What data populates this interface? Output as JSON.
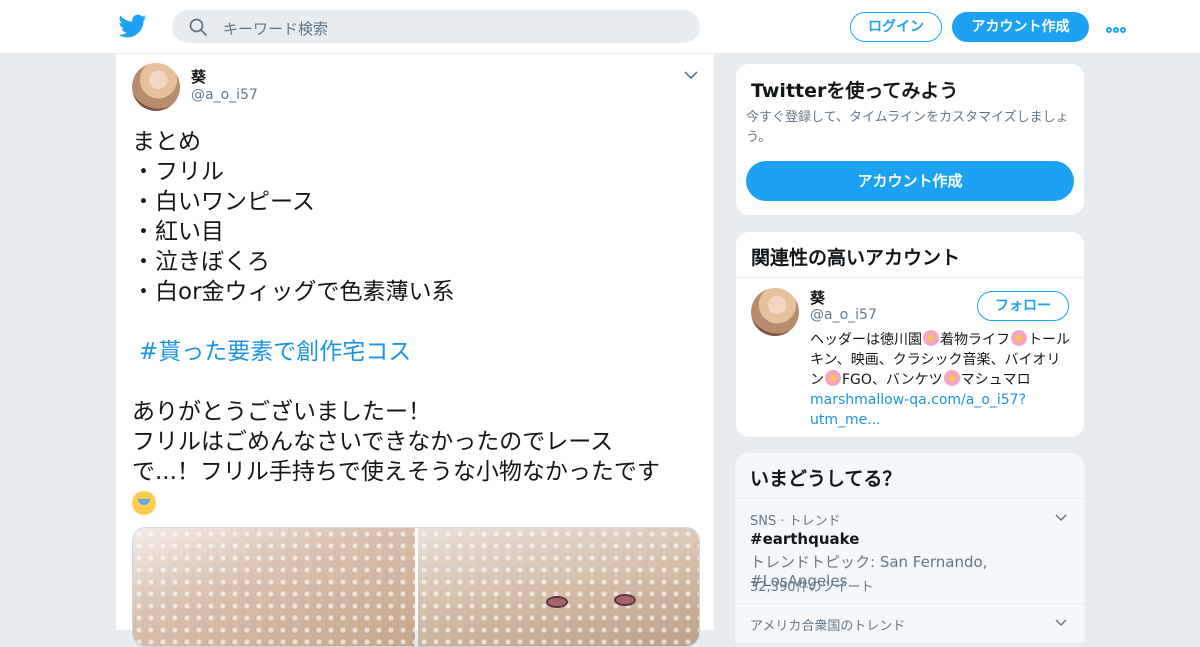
{
  "header": {
    "search_placeholder": "キーワード検索",
    "login_label": "ログイン",
    "signup_label": "アカウント作成"
  },
  "tweet": {
    "name": "葵",
    "handle": "@a_o_i57",
    "lines": [
      "まとめ",
      "・フリル",
      "・白いワンピース",
      "・紅い目",
      "・泣きぼくろ",
      "・白or金ウィッグで色素薄い系"
    ],
    "hashtag": "#貰った要素で創作宅コス",
    "lines2": [
      "ありがとうございましたー！",
      "フリルはごめんなさいできなかったのでレース",
      "で...！フリル手持ちで使えそうな小物なかったです"
    ],
    "emoji": "loudly-crying-face"
  },
  "signup_card": {
    "title": "Twitterを使ってみよう",
    "desc": "今すぐ登録して、タイムラインをカスタマイズしましょう。",
    "cta": "アカウント作成"
  },
  "related_card": {
    "title": "関連性の高いアカウント",
    "name": "葵",
    "handle": "@a_o_i57",
    "follow_label": "フォロー",
    "bio_parts": [
      "ヘッダーは徳川園",
      "着物ライフ",
      "トールキン、映画、クラシック音楽、バイオリン",
      "FGO、バンケツ",
      "マシュマロ"
    ],
    "bio_link": "marshmallow-qa.com/a_o_i57?utm_me..."
  },
  "trends_card": {
    "title": "いまどうしてる？",
    "trend1_meta": "SNS · トレンド",
    "trend1_tag": "#earthquake",
    "trend1_topic": "トレンドトピック: San Fernando, #LosAngeles",
    "trend1_count": "32,390件のツイート",
    "trend2_meta": "アメリカ合衆国のトレンド"
  },
  "colors": {
    "accent": "#1da1f2",
    "link": "#1b95e0",
    "muted": "#657786",
    "background": "#e6ecf0"
  }
}
